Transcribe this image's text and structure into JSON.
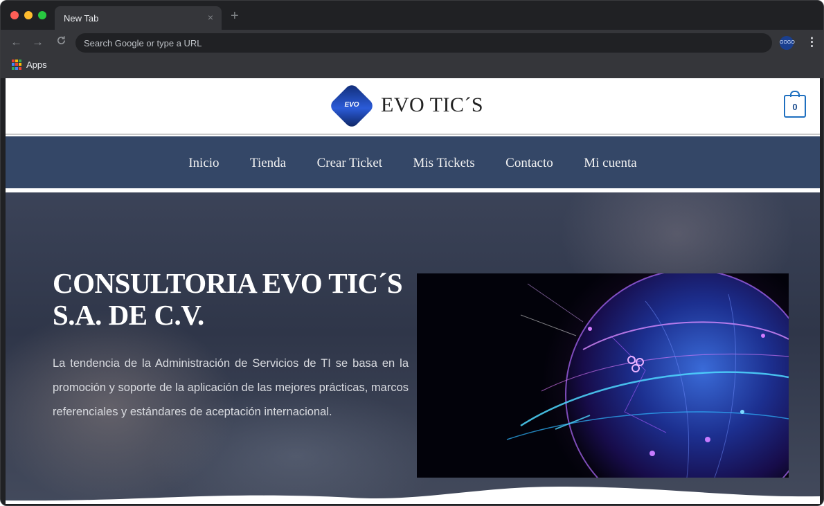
{
  "browser": {
    "tab_title": "New Tab",
    "tab_close": "×",
    "new_tab": "+",
    "back": "←",
    "forward": "→",
    "reload": "C",
    "omnibox_placeholder": "Search Google or type a URL",
    "profile": "GOGO",
    "menu": "⋮",
    "bookmarks": {
      "apps_label": "Apps"
    }
  },
  "site": {
    "logo_mark": "EVO",
    "logo_text": "EVO TIC´S",
    "cart_count": "0",
    "nav": [
      "Inicio",
      "Tienda",
      "Crear Ticket",
      "Mis Tickets",
      "Contacto",
      "Mi cuenta"
    ],
    "hero": {
      "title_line1": "CONSULTORIA EVO TIC´S",
      "title_line2": "S.A. DE C.V.",
      "description": "La tendencia de la Administración de Servicios de TI se basa en la promoción y soporte de la aplicación de las mejores prácticas, marcos referenciales y estándares de aceptación internacional."
    }
  },
  "colors": {
    "nav_bg": "#344767",
    "accent": "#1e6fbf",
    "chrome_dark": "#202124",
    "chrome_toolbar": "#35363a"
  },
  "icons": {
    "back": "arrow-left-icon",
    "forward": "arrow-right-icon",
    "reload": "reload-icon",
    "apps": "apps-grid-icon",
    "cart": "shopping-bag-icon",
    "menu": "kebab-menu-icon"
  }
}
